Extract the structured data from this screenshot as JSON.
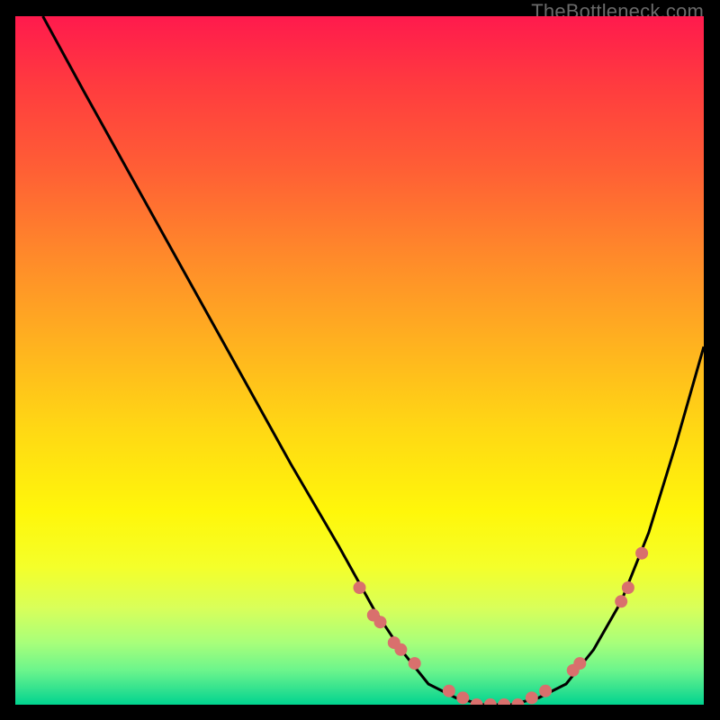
{
  "watermark": "TheBottleneck.com",
  "chart_data": {
    "type": "line",
    "title": "",
    "xlabel": "",
    "ylabel": "",
    "xlim": [
      0,
      100
    ],
    "ylim": [
      0,
      100
    ],
    "grid": false,
    "legend": false,
    "series": [
      {
        "name": "bottleneck-curve",
        "x": [
          4,
          10,
          20,
          30,
          40,
          47,
          52,
          56,
          60,
          64,
          68,
          72,
          76,
          80,
          84,
          88,
          92,
          96,
          100
        ],
        "y": [
          100,
          89,
          71,
          53,
          35,
          23,
          14,
          8,
          3,
          1,
          0,
          0,
          1,
          3,
          8,
          15,
          25,
          38,
          52
        ]
      }
    ],
    "points": {
      "name": "sample-points",
      "x": [
        50,
        52,
        53,
        55,
        56,
        58,
        63,
        65,
        67,
        69,
        71,
        73,
        75,
        77,
        81,
        82,
        88,
        89,
        91
      ],
      "y": [
        17,
        13,
        12,
        9,
        8,
        6,
        2,
        1,
        0,
        0,
        0,
        0,
        1,
        2,
        5,
        6,
        15,
        17,
        22
      ]
    },
    "colors": {
      "curve": "#000000",
      "points": "#d9706d",
      "gradient_top": "#ff1a4d",
      "gradient_mid": "#fff70a",
      "gradient_bottom": "#00d48f",
      "frame": "#000000"
    }
  }
}
